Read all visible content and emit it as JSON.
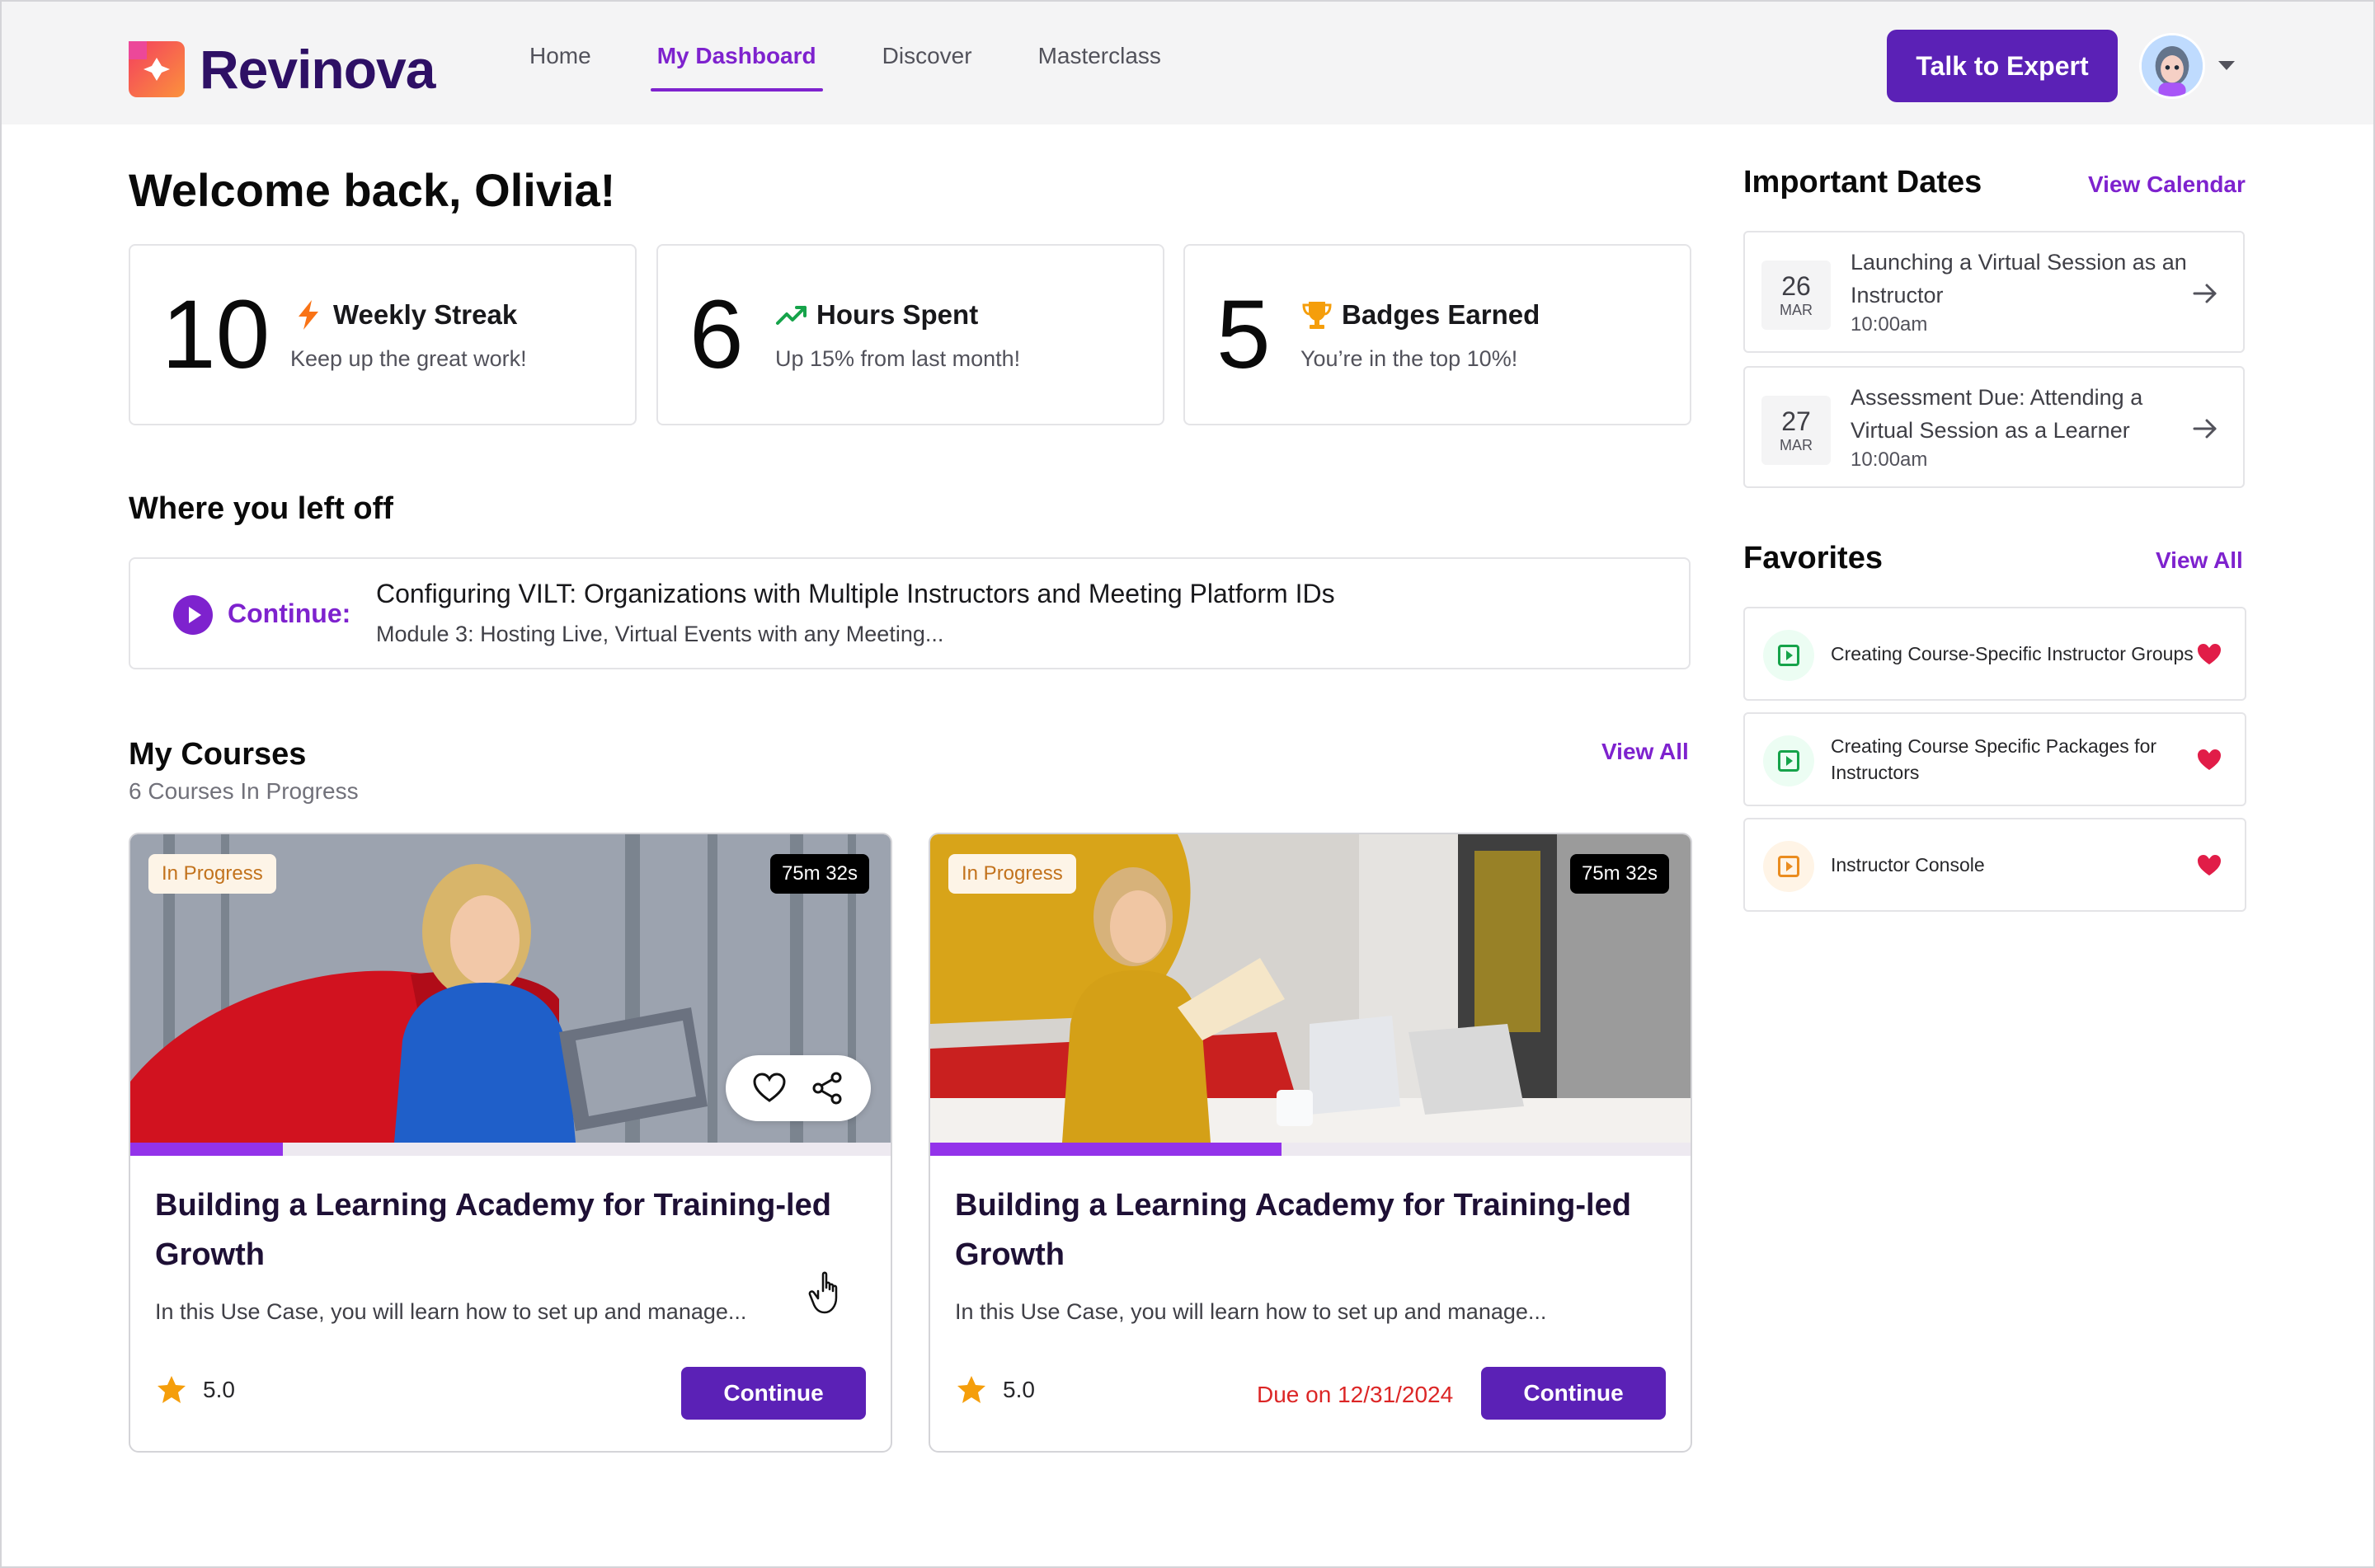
{
  "app": {
    "name": "Revinova",
    "brand_color": "#5b21b6",
    "accent_color": "#7e22ce"
  },
  "nav": {
    "items": [
      {
        "label": "Home",
        "active": false
      },
      {
        "label": "My Dashboard",
        "active": true
      },
      {
        "label": "Discover",
        "active": false
      },
      {
        "label": "Masterclass",
        "active": false
      }
    ],
    "cta_label": "Talk to Expert"
  },
  "welcome": "Welcome back, Olivia!",
  "stats": [
    {
      "value": "10",
      "title": "Weekly Streak",
      "subtitle": "Keep up the great work!",
      "icon": "lightning-icon"
    },
    {
      "value": "6",
      "title": "Hours Spent",
      "subtitle": "Up 15% from last month!",
      "icon": "trending-up-icon"
    },
    {
      "value": "5",
      "title": "Badges Earned",
      "subtitle": "You’re in the top 10%!",
      "icon": "trophy-icon"
    }
  ],
  "left_off": {
    "heading": "Where you left off",
    "continue_label": "Continue:",
    "title": "Configuring VILT: Organizations with Multiple Instructors and Meeting Platform IDs",
    "subtitle": "Module 3: Hosting Live, Virtual Events with any Meeting..."
  },
  "courses": {
    "heading": "My Courses",
    "count_text": "6 Courses In Progress",
    "view_all": "View All",
    "items": [
      {
        "status": "In Progress",
        "duration": "75m 32s",
        "progress": 0.2,
        "title": "Building a Learning Academy for Training-led Growth",
        "description": "In this Use Case, you will learn how to set up and manage...",
        "rating": "5.0",
        "due": "",
        "button": "Continue"
      },
      {
        "status": "In Progress",
        "duration": "75m 32s",
        "progress": 0.46,
        "title": "Building a Learning Academy for Training-led Growth",
        "description": "In this Use Case, you will learn how to set up and manage...",
        "rating": "5.0",
        "due": "Due on 12/31/2024",
        "button": "Continue"
      }
    ]
  },
  "important_dates": {
    "heading": "Important Dates",
    "link": "View Calendar",
    "items": [
      {
        "day": "26",
        "month": "MAR",
        "title": "Launching a Virtual Session as an Instructor",
        "time": "10:00am"
      },
      {
        "day": "27",
        "month": "MAR",
        "title": "Assessment Due: Attending a Virtual Session as a Learner",
        "time": "10:00am"
      }
    ]
  },
  "favorites": {
    "heading": "Favorites",
    "link": "View All",
    "items": [
      {
        "title": "Creating Course-Specific Instructor Groups",
        "icon_color": "#16a34a",
        "icon_bg": "#ecfdf3"
      },
      {
        "title": "Creating Course Specific Packages for Instructors",
        "icon_color": "#16a34a",
        "icon_bg": "#ecfdf3"
      },
      {
        "title": "Instructor Console",
        "icon_color": "#ea8c1f",
        "icon_bg": "#fff4e6"
      }
    ]
  }
}
